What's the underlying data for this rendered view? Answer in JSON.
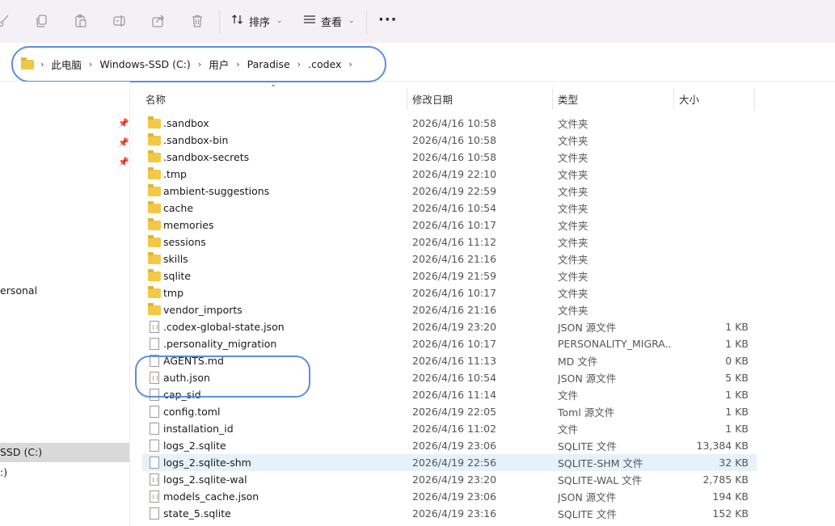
{
  "toolbar": {
    "sort_label": "排序",
    "view_label": "查看",
    "more_label": "···",
    "icons": [
      "cut-icon",
      "copy-icon",
      "paste-icon",
      "rename-icon",
      "share-icon",
      "delete-icon"
    ]
  },
  "address": {
    "crumbs": [
      "此电脑",
      "Windows-SSD (C:)",
      "用户",
      "Paradise",
      ".codex"
    ]
  },
  "nav": {
    "labels": [
      "ersonal",
      "SSD (C:)",
      ":)"
    ]
  },
  "columns": {
    "name": "名称",
    "date": "修改日期",
    "type": "类型",
    "size": "大小"
  },
  "files": [
    {
      "name": ".sandbox",
      "date": "2026/4/16 10:58",
      "type": "文件夹",
      "size": "",
      "kind": "folder"
    },
    {
      "name": ".sandbox-bin",
      "date": "2026/4/16 10:58",
      "type": "文件夹",
      "size": "",
      "kind": "folder"
    },
    {
      "name": ".sandbox-secrets",
      "date": "2026/4/16 10:58",
      "type": "文件夹",
      "size": "",
      "kind": "folder"
    },
    {
      "name": ".tmp",
      "date": "2026/4/19 22:10",
      "type": "文件夹",
      "size": "",
      "kind": "folder"
    },
    {
      "name": "ambient-suggestions",
      "date": "2026/4/19 22:59",
      "type": "文件夹",
      "size": "",
      "kind": "folder"
    },
    {
      "name": "cache",
      "date": "2026/4/16 10:54",
      "type": "文件夹",
      "size": "",
      "kind": "folder"
    },
    {
      "name": "memories",
      "date": "2026/4/16 10:17",
      "type": "文件夹",
      "size": "",
      "kind": "folder"
    },
    {
      "name": "sessions",
      "date": "2026/4/16 11:12",
      "type": "文件夹",
      "size": "",
      "kind": "folder"
    },
    {
      "name": "skills",
      "date": "2026/4/16 21:16",
      "type": "文件夹",
      "size": "",
      "kind": "folder"
    },
    {
      "name": "sqlite",
      "date": "2026/4/19 21:59",
      "type": "文件夹",
      "size": "",
      "kind": "folder"
    },
    {
      "name": "tmp",
      "date": "2026/4/16 10:17",
      "type": "文件夹",
      "size": "",
      "kind": "folder"
    },
    {
      "name": "vendor_imports",
      "date": "2026/4/16 21:16",
      "type": "文件夹",
      "size": "",
      "kind": "folder"
    },
    {
      "name": ".codex-global-state.json",
      "date": "2026/4/19 23:20",
      "type": "JSON 源文件",
      "size": "1 KB",
      "kind": "json"
    },
    {
      "name": ".personality_migration",
      "date": "2026/4/16 10:17",
      "type": "PERSONALITY_MIGRA...",
      "size": "1 KB",
      "kind": "file"
    },
    {
      "name": "AGENTS.md",
      "date": "2026/4/16 11:13",
      "type": "MD 文件",
      "size": "0 KB",
      "kind": "file"
    },
    {
      "name": "auth.json",
      "date": "2026/4/16 10:54",
      "type": "JSON 源文件",
      "size": "5 KB",
      "kind": "json"
    },
    {
      "name": "cap_sid",
      "date": "2026/4/16 11:14",
      "type": "文件",
      "size": "1 KB",
      "kind": "file"
    },
    {
      "name": "config.toml",
      "date": "2026/4/19 22:05",
      "type": "Toml 源文件",
      "size": "1 KB",
      "kind": "file"
    },
    {
      "name": "installation_id",
      "date": "2026/4/16 11:02",
      "type": "文件",
      "size": "1 KB",
      "kind": "file"
    },
    {
      "name": "logs_2.sqlite",
      "date": "2026/4/19 23:06",
      "type": "SQLITE 文件",
      "size": "13,384 KB",
      "kind": "file"
    },
    {
      "name": "logs_2.sqlite-shm",
      "date": "2026/4/19 22:56",
      "type": "SQLITE-SHM 文件",
      "size": "32 KB",
      "kind": "file",
      "selected": true
    },
    {
      "name": "logs_2.sqlite-wal",
      "date": "2026/4/19 23:20",
      "type": "SQLITE-WAL 文件",
      "size": "2,785 KB",
      "kind": "json"
    },
    {
      "name": "models_cache.json",
      "date": "2026/4/19 23:06",
      "type": "JSON 源文件",
      "size": "194 KB",
      "kind": "json"
    },
    {
      "name": "state_5.sqlite",
      "date": "2026/4/19 23:16",
      "type": "SQLITE 文件",
      "size": "152 KB",
      "kind": "file"
    }
  ]
}
